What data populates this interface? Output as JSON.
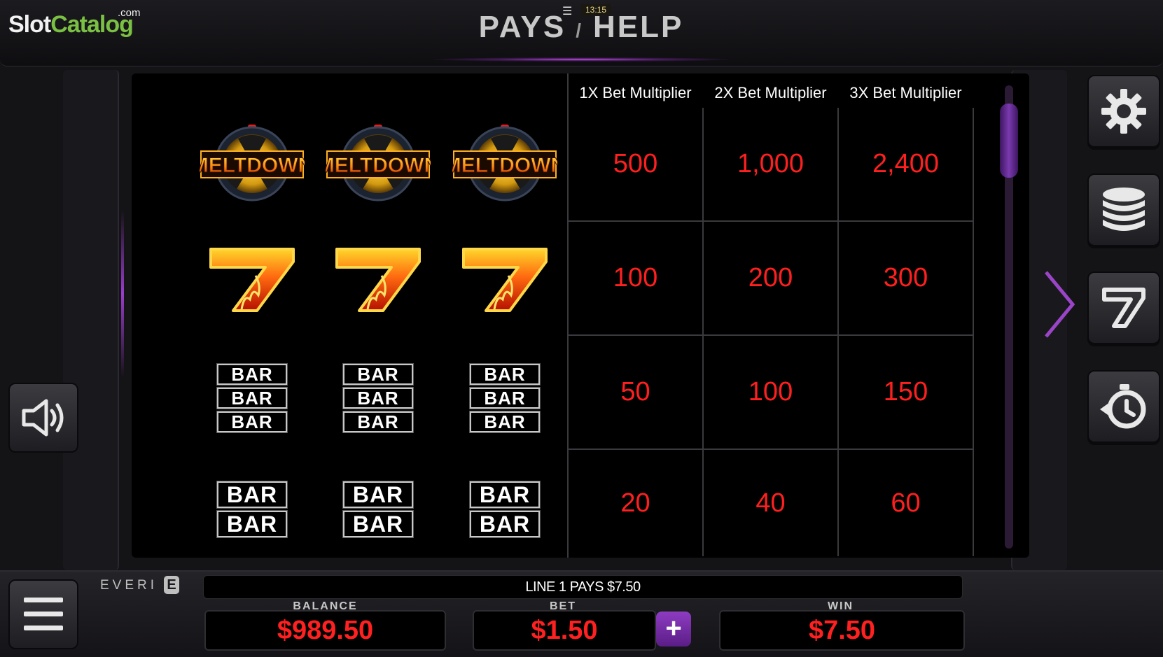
{
  "header": {
    "logo_main": "Slot",
    "logo_accent": "Catalog",
    "logo_suffix": ".com",
    "title_left": "PAYS",
    "title_sep": "/",
    "title_right": "HELP",
    "clock": "13:15",
    "menu_icon": "hamburger-icon"
  },
  "paytable": {
    "columns": [
      "1X Bet Multiplier",
      "2X Bet Multiplier",
      "3X Bet Multiplier"
    ],
    "rows": [
      {
        "symbol": "meltdown",
        "symbol_text": "MELTDOWN",
        "pays": [
          "500",
          "1,000",
          "2,400"
        ]
      },
      {
        "symbol": "seven",
        "symbol_text": "7",
        "pays": [
          "100",
          "200",
          "300"
        ]
      },
      {
        "symbol": "triple-bar",
        "symbol_text": "BAR",
        "pays": [
          "50",
          "100",
          "150"
        ]
      },
      {
        "symbol": "double-bar",
        "symbol_text": "BAR",
        "pays": [
          "20",
          "40",
          "60"
        ]
      }
    ]
  },
  "right_buttons": [
    "gear-icon",
    "coins-icon",
    "seven-icon",
    "autoplay-icon"
  ],
  "left_buttons": [
    "speaker-icon",
    "menu-icon"
  ],
  "bottom": {
    "brand": "EVERI",
    "brand_mark": "E",
    "message": "LINE 1 PAYS $7.50",
    "balance_label": "BALANCE",
    "balance_value": "$989.50",
    "bet_label": "BET",
    "bet_value": "$1.50",
    "bet_plus": "+",
    "win_label": "WIN",
    "win_value": "$7.50"
  },
  "colors": {
    "value_red": "#ff1f1f",
    "accent_purple": "#8e3cc2",
    "logo_green": "#7ac043"
  }
}
